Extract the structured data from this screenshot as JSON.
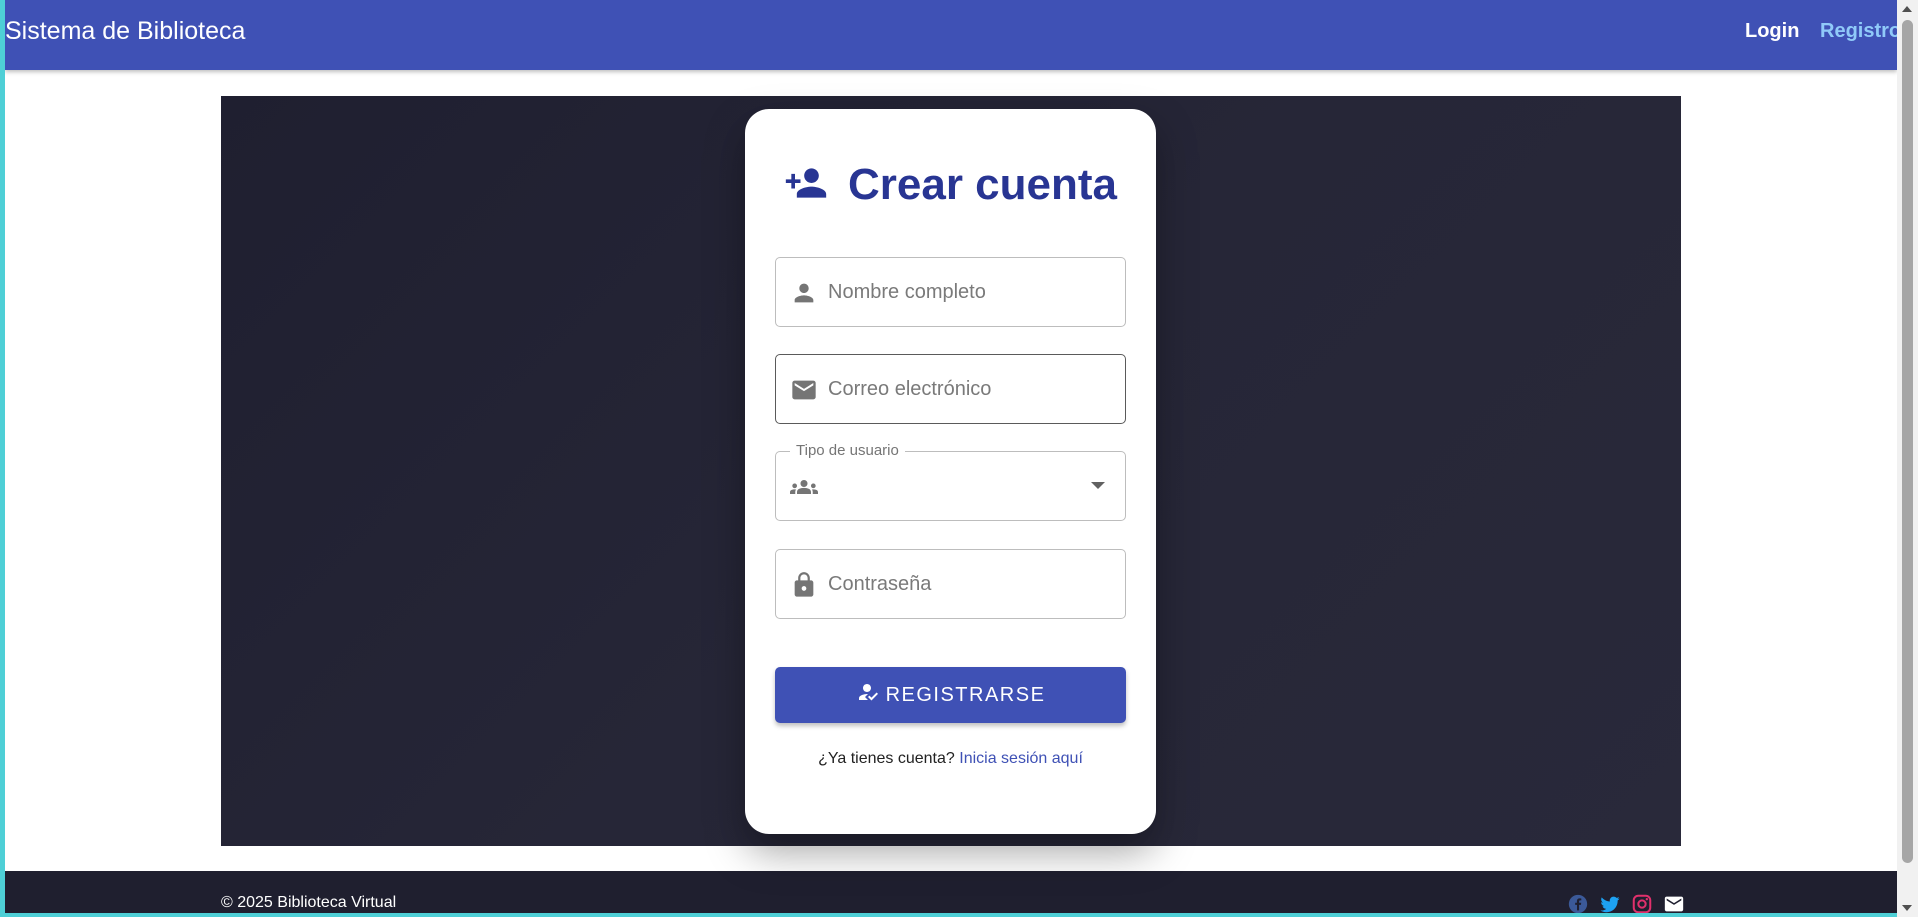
{
  "appbar": {
    "brand": "Sistema de Biblioteca",
    "nav": {
      "login": "Login",
      "register": "Registro"
    }
  },
  "card": {
    "title": "Crear cuenta",
    "fields": {
      "name_placeholder": "Nombre completo",
      "email_placeholder": "Correo electrónico",
      "user_type_label": "Tipo de usuario",
      "user_type_value": "",
      "password_placeholder": "Contraseña"
    },
    "submit_label": "REGISTRARSE",
    "login_prompt": "¿Ya tienes cuenta?",
    "login_link": "Inicia sesión aquí"
  },
  "footer": {
    "copyright": "© 2025 Biblioteca Virtual",
    "social_icons": [
      "facebook-icon",
      "twitter-icon",
      "instagram-icon",
      "mail-icon"
    ]
  },
  "colors": {
    "primary": "#3f51b5",
    "title": "#283593",
    "nav_active": "#90caf9",
    "hero_bg": "#262637",
    "footer_bg": "#1f1f2f",
    "facebook": "#3b5998",
    "twitter": "#1da1f2",
    "instagram": "#e1306c"
  }
}
